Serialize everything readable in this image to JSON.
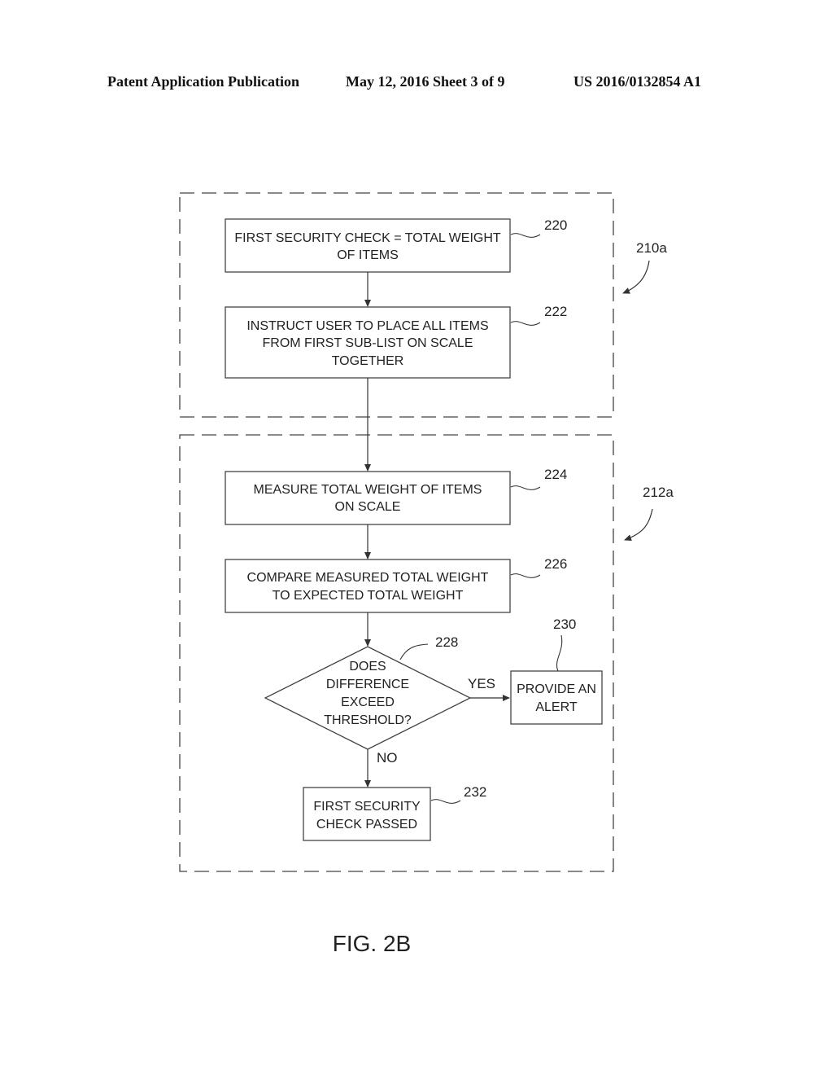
{
  "header": {
    "publication": "Patent Application Publication",
    "date_sheet": "May 12, 2016   Sheet 3 of 9",
    "number": "US 2016/0132854 A1"
  },
  "groups": [
    {
      "ref": "210a"
    },
    {
      "ref": "212a"
    }
  ],
  "steps": {
    "s220": {
      "ref": "220",
      "lines": [
        "FIRST SECURITY CHECK = TOTAL WEIGHT",
        "OF ITEMS"
      ]
    },
    "s222": {
      "ref": "222",
      "lines": [
        "INSTRUCT USER TO PLACE ALL ITEMS",
        "FROM FIRST SUB-LIST ON SCALE",
        "TOGETHER"
      ]
    },
    "s224": {
      "ref": "224",
      "lines": [
        "MEASURE TOTAL WEIGHT OF ITEMS",
        "ON SCALE"
      ]
    },
    "s226": {
      "ref": "226",
      "lines": [
        "COMPARE MEASURED TOTAL WEIGHT",
        "TO EXPECTED TOTAL WEIGHT"
      ]
    },
    "s228": {
      "ref": "228",
      "lines": [
        "DOES",
        "DIFFERENCE",
        "EXCEED",
        "THRESHOLD?"
      ]
    },
    "s230": {
      "ref": "230",
      "lines": [
        "PROVIDE AN",
        "ALERT"
      ]
    },
    "s232": {
      "ref": "232",
      "lines": [
        "FIRST SECURITY",
        "CHECK PASSED"
      ]
    }
  },
  "edges": {
    "yes": "YES",
    "no": "NO"
  },
  "figure_label": "FIG. 2B"
}
